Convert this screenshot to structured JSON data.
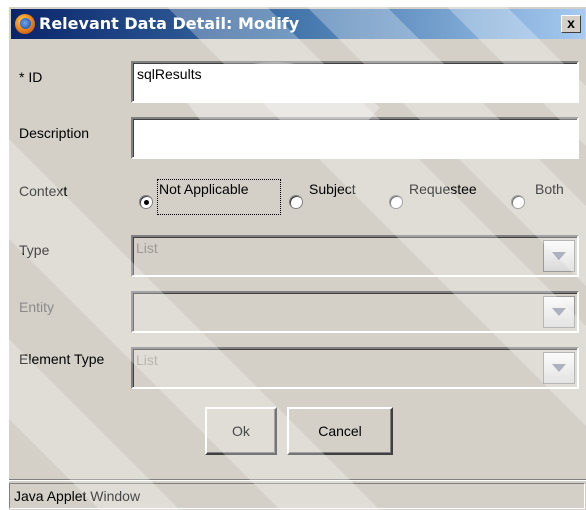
{
  "window": {
    "title": "Relevant Data Detail: Modify",
    "close_label": "x"
  },
  "form": {
    "id_label": "* ID",
    "id_value": "sqlResults",
    "description_label": "Description",
    "description_value": "",
    "context_label": "Context",
    "context_options": [
      "Not Applicable",
      "Subject",
      "Requestee",
      "Both"
    ],
    "context_selected": "Not Applicable",
    "type_label": "Type",
    "type_value": "List",
    "entity_label": "Entity",
    "entity_value": "",
    "element_type_label": "Element Type",
    "element_type_value": "List"
  },
  "buttons": {
    "ok": "Ok",
    "cancel": "Cancel"
  },
  "status": {
    "text": "Java Applet Window"
  },
  "icons": {
    "app": "browser-globe-icon",
    "dropdown": "chevron-down-icon"
  },
  "colors": {
    "dialog_bg": "#d4d0c8",
    "title_start": "#0a246a",
    "title_end": "#a6caf0",
    "disabled_text": "#8a8a8a"
  }
}
